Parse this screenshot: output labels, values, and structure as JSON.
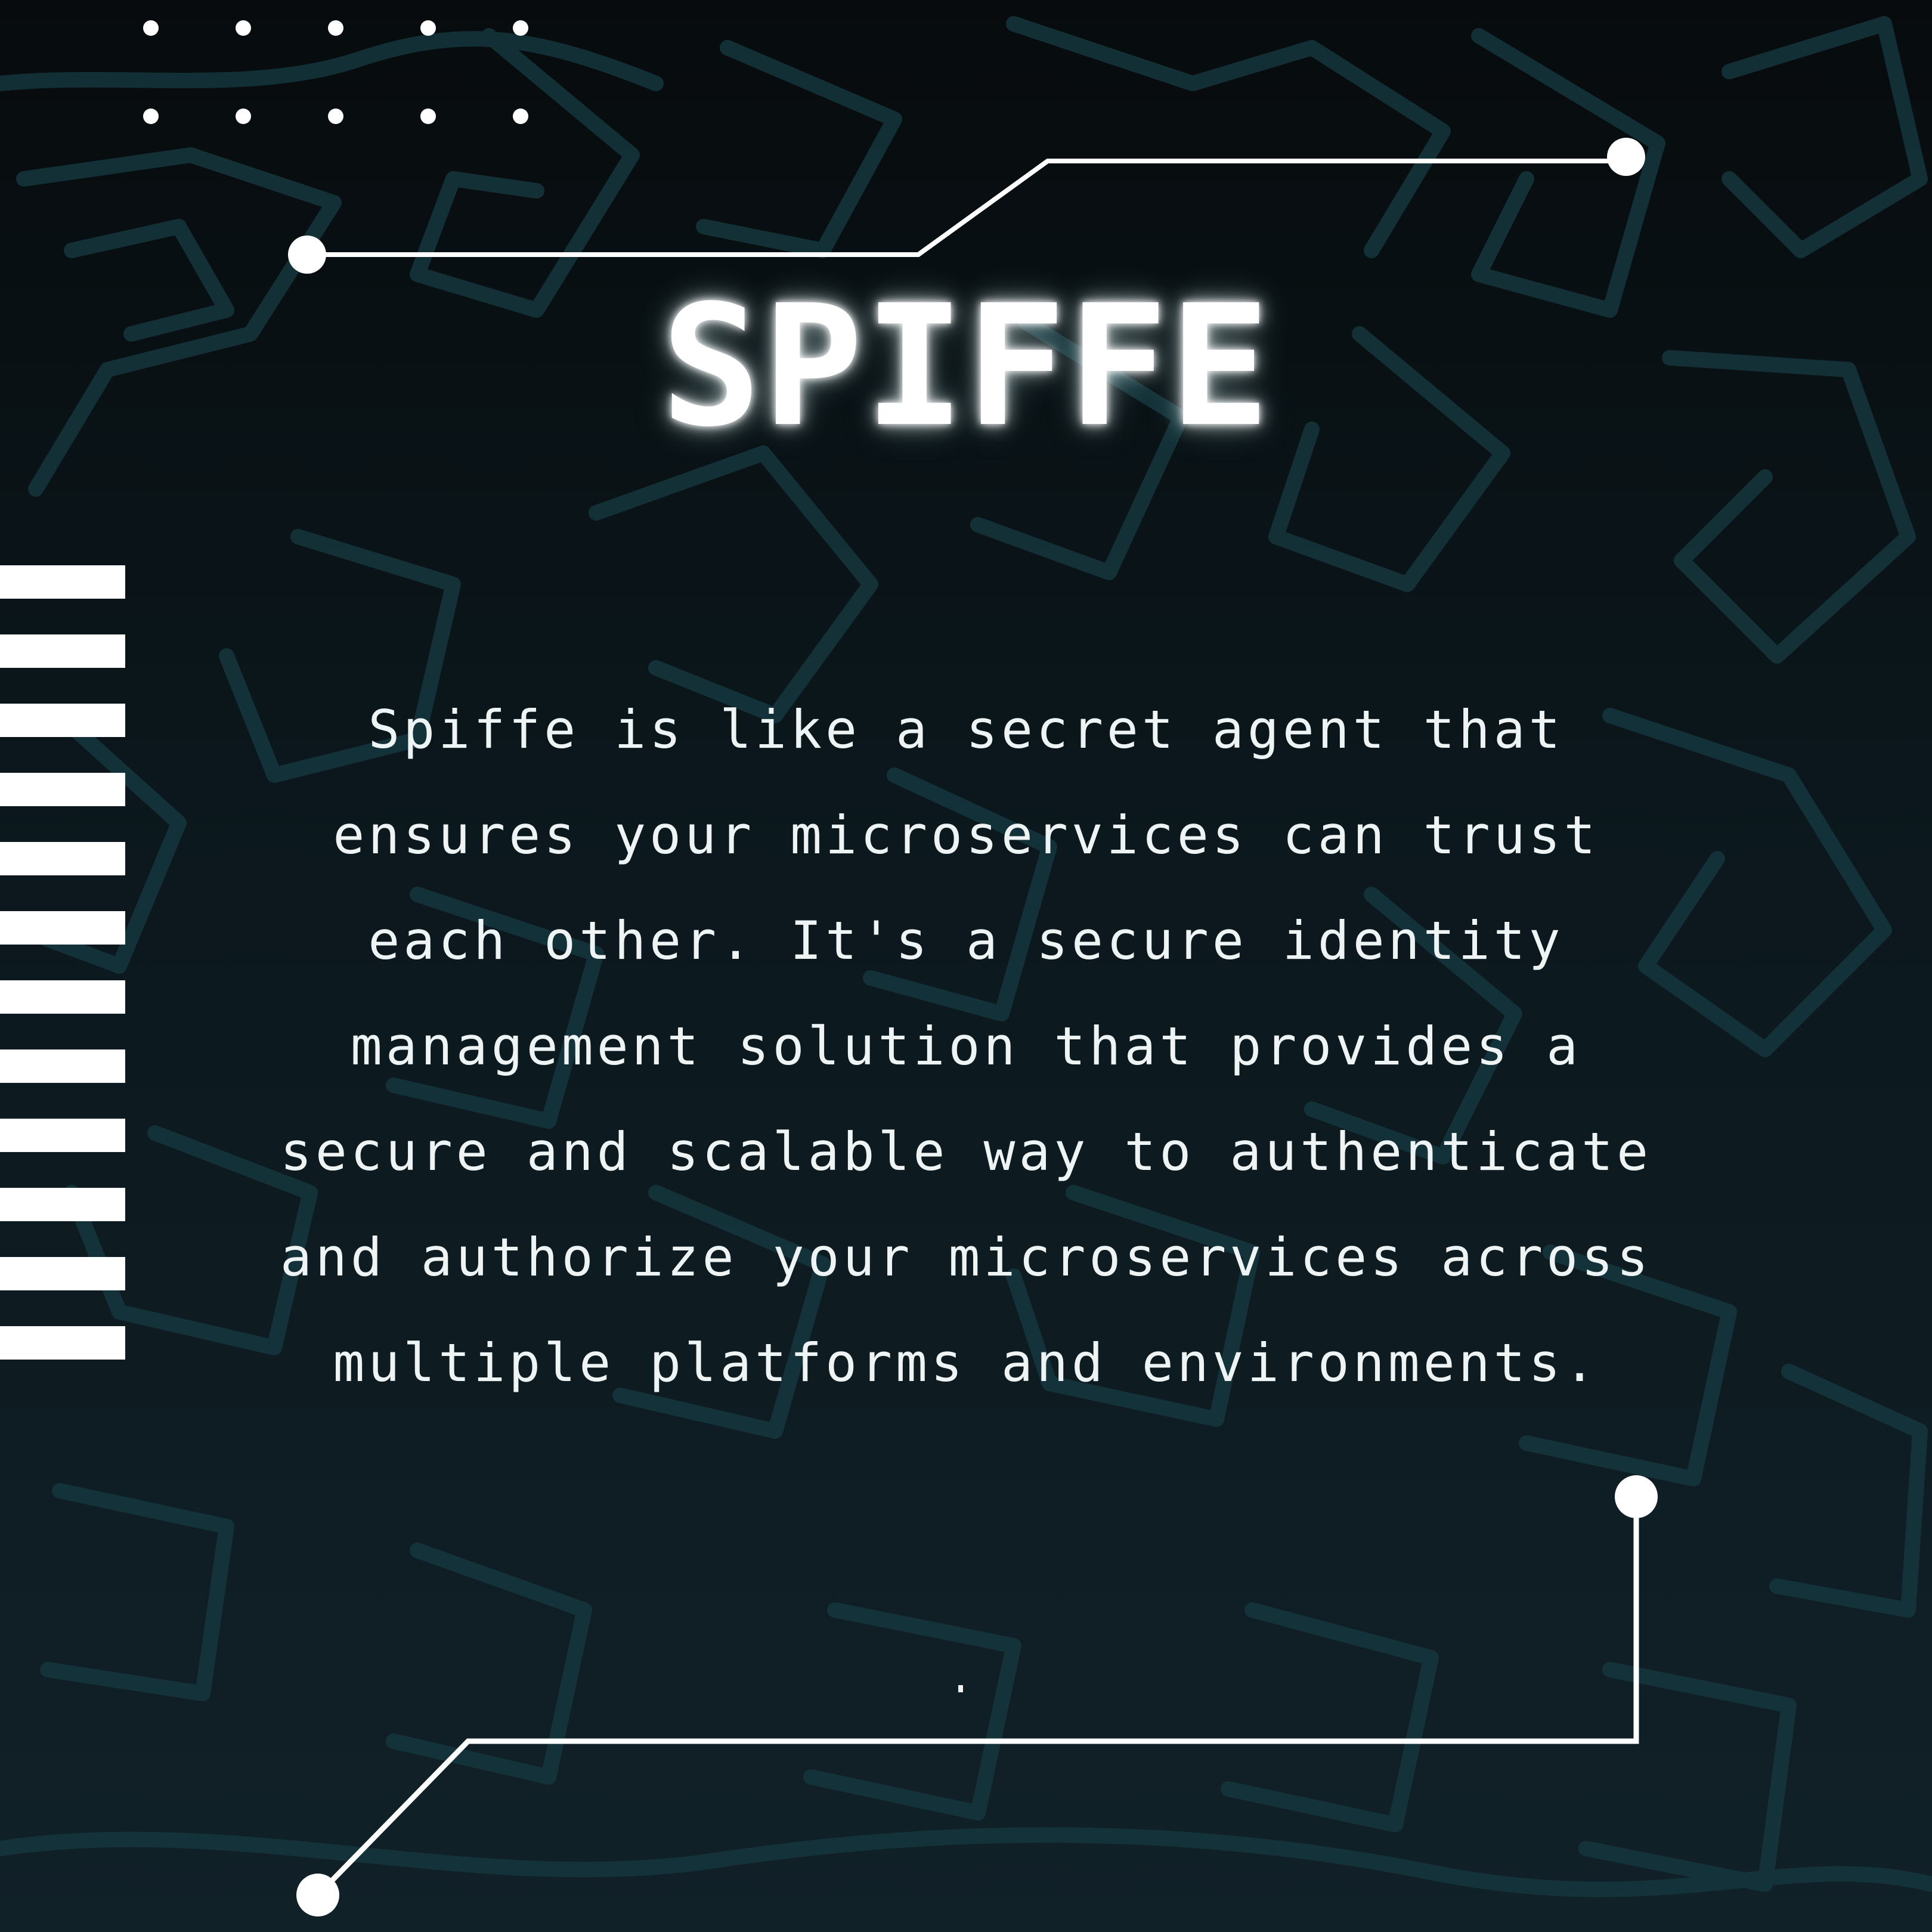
{
  "title": "SPIFFE",
  "body_lines": [
    "Spiffe is like a secret agent that",
    "ensures your microservices can trust",
    "each other. It's a secure identity",
    "management solution that provides a",
    "secure and scalable way to authenticate",
    "and authorize your microservices across",
    "multiple platforms and environments."
  ],
  "colors": {
    "background_top": "#070b0d",
    "background_bottom": "#112128",
    "pattern": "#15363d",
    "text": "#ffffff"
  }
}
